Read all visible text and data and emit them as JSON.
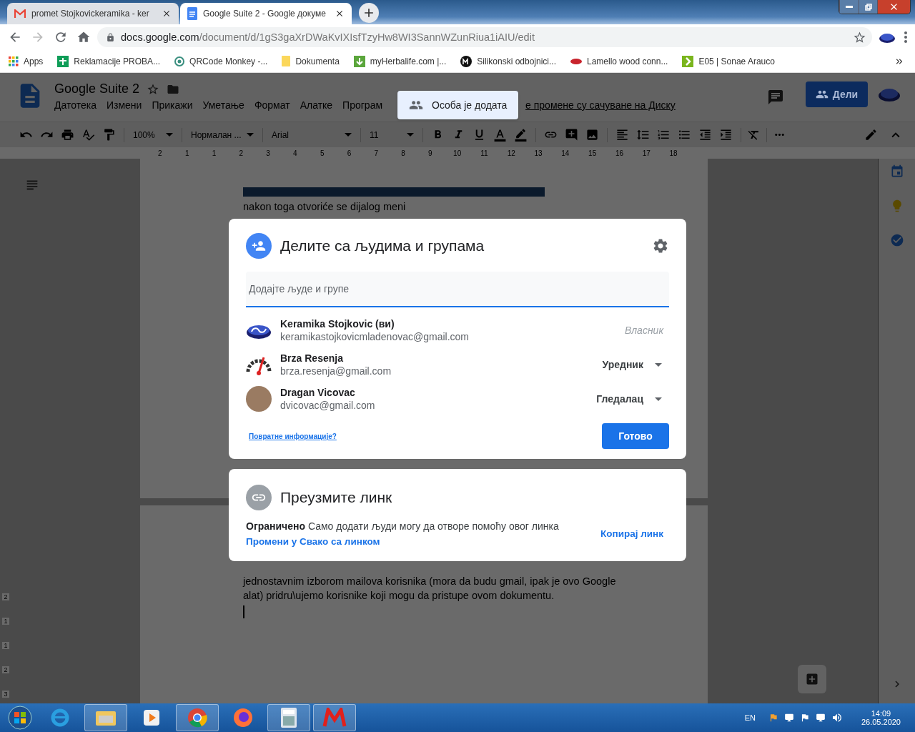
{
  "browser": {
    "tabs": [
      {
        "title": "promet Stojkovickeramika - ker",
        "kind": "mail",
        "selected": false
      },
      {
        "title": "Google Suite 2 - Google докуме",
        "kind": "docs",
        "selected": true
      }
    ],
    "url_host": "docs.google.com",
    "url_path": "/document/d/1gS3gaXrDWaKvIXIsfTzyHw8WI3SannWZunRiua1iAIU/edit",
    "bookmarks": [
      {
        "label": "Apps",
        "kind": "apps"
      },
      {
        "label": "Reklamacije PROBA...",
        "kind": "sheet"
      },
      {
        "label": "QRCode Monkey -...",
        "kind": "qr"
      },
      {
        "label": "Dokumenta",
        "kind": "folder"
      },
      {
        "label": "myHerbalife.com |...",
        "kind": "herbal"
      },
      {
        "label": "Silikonski odbojnici...",
        "kind": "mf"
      },
      {
        "label": "Lamello wood conn...",
        "kind": "lamello"
      },
      {
        "label": "E05 | Sonae Arauco",
        "kind": "sonae"
      }
    ]
  },
  "docs": {
    "title": "Google Suite 2",
    "menus": [
      "Датотека",
      "Измени",
      "Прикажи",
      "Уметање",
      "Формат",
      "Алатке",
      "Програм"
    ],
    "save_status": "е промене су сачуване на Диску",
    "share_button": "Дели",
    "zoom": "100%",
    "style": "Нормалан ...",
    "font": "Arial",
    "size": "11",
    "ruler_labels": [
      "2",
      "1",
      "1",
      "2",
      "3",
      "4",
      "5",
      "6",
      "7",
      "8",
      "9",
      "10",
      "11",
      "12",
      "13",
      "14",
      "15",
      "16",
      "17",
      "18"
    ],
    "side_ruler_labels": [
      "2",
      "1",
      "1",
      "2",
      "3"
    ],
    "page1_text": "nakon toga otvoriće se dijalog meni",
    "page2_text": "jednostavnim izborom mailova korisnika (mora da budu gmail, ipak je ovo Google alat) pridru\\ujemo korisnike koji mogu da pristupe ovom dokumentu."
  },
  "toast": "Особа је додата",
  "share_dialog": {
    "title": "Делите са људима и групама",
    "placeholder": "Додајте људе и групе",
    "people": [
      {
        "name": "Keramika Stojkovic (ви)",
        "email": "keramikastojkovicmladenovac@gmail.com",
        "role": "Власник",
        "kind": "logo",
        "editable": false
      },
      {
        "name": "Brza Resenja",
        "email": "brza.resenja@gmail.com",
        "role": "Уредник",
        "kind": "gauge",
        "editable": true
      },
      {
        "name": "Dragan Vicovac",
        "email": "dvicovac@gmail.com",
        "role": "Гледалац",
        "kind": "photo",
        "editable": true
      }
    ],
    "feedback_link": "Повратне информације?",
    "done_button": "Готово"
  },
  "link_dialog": {
    "title": "Преузмите линк",
    "restriction_label": "Ограничено",
    "restriction_text": "Само додати људи могу да отворе помоћу овог линка",
    "change_link": "Промени у Свако са линком",
    "copy_link": "Копирај линк"
  },
  "taskbar": {
    "language": "EN",
    "time": "14:09",
    "date": "26.05.2020"
  }
}
